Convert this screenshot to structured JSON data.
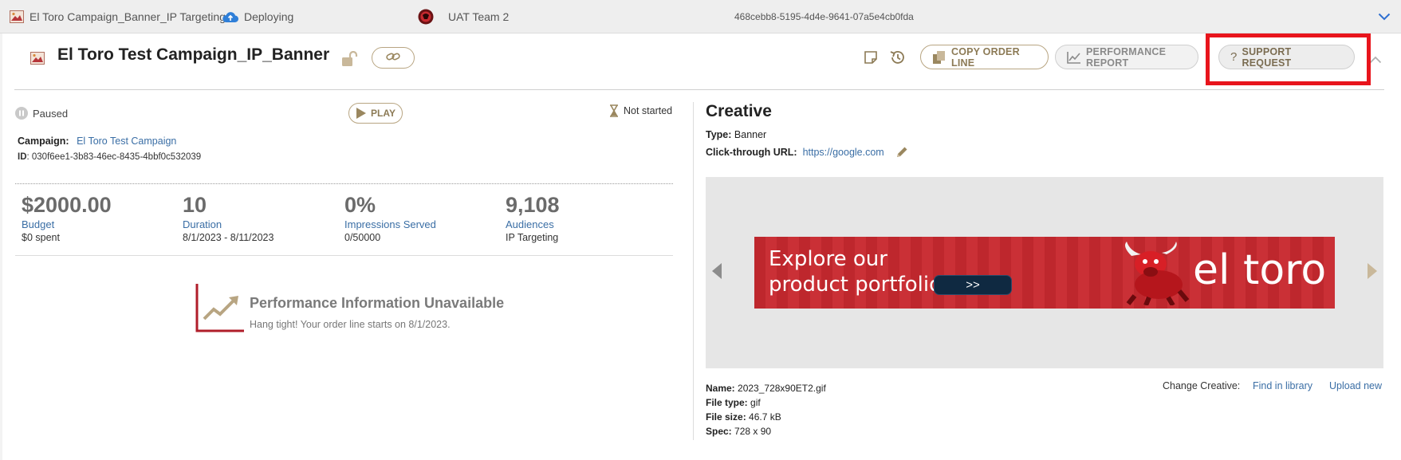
{
  "topbar": {
    "campaign_name": "El Toro Campaign_Banner_IP Targeting",
    "deploy_status": "Deploying",
    "team": "UAT Team 2",
    "uuid": "468cebb8-5195-4d4e-9641-07a5e4cb0fda"
  },
  "header": {
    "title": "El Toro Test Campaign_IP_Banner",
    "copy_order_line": "COPY ORDER LINE",
    "performance_report": "PERFORMANCE REPORT",
    "support_request": "SUPPORT REQUEST"
  },
  "left": {
    "status": "Paused",
    "play_label": "PLAY",
    "timing_status": "Not started",
    "campaign_label": "Campaign:",
    "campaign_name": "El Toro Test Campaign",
    "id_label": "ID",
    "id_value": ": 030f6ee1-3b83-46ec-8435-4bbf0c532039",
    "metrics": [
      {
        "value": "$2000.00",
        "label": "Budget",
        "sub": "$0 spent"
      },
      {
        "value": "10",
        "label": "Duration",
        "sub": "8/1/2023 - 8/11/2023"
      },
      {
        "value": "0%",
        "label": "Impressions Served",
        "sub": "0/50000"
      },
      {
        "value": "9,108",
        "label": "Audiences",
        "sub": "IP Targeting"
      }
    ],
    "perf_title": "Performance Information Unavailable",
    "perf_sub": "Hang tight! Your order line starts on 8/1/2023."
  },
  "right": {
    "title": "Creative",
    "type_label": "Type:",
    "type_value": "Banner",
    "url_label": "Click-through URL:",
    "url_value": "https://google.com",
    "banner": {
      "line1": "Explore our",
      "line2": "product portfolio",
      "button": ">>",
      "brand": "el toro"
    },
    "name_label": "Name:",
    "name_value": "2023_728x90ET2.gif",
    "filetype_label": "File type:",
    "filetype_value": "gif",
    "filesize_label": "File size:",
    "filesize_value": "46.7 kB",
    "spec_label": "Spec:",
    "spec_value": "728 x 90",
    "change_creative": "Change Creative:",
    "find_in_library": "Find in library",
    "upload_new": "Upload new"
  },
  "colors": {
    "accent_gold": "#b8a582",
    "link_blue": "#3a6ea5",
    "highlight_red": "#e8141c",
    "banner_red": "#c8292f"
  }
}
